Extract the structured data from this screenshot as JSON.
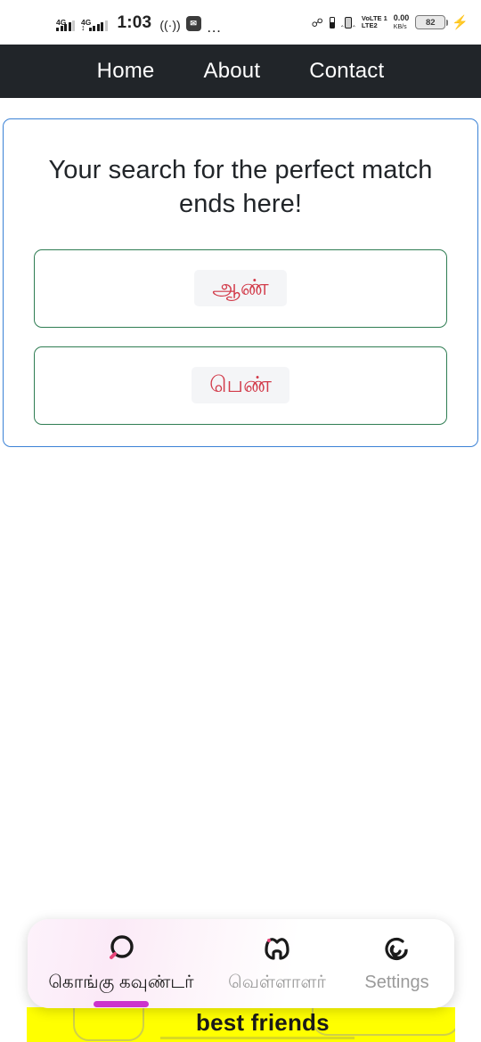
{
  "status_bar": {
    "network_1": "4G",
    "network_2": "4G",
    "time": "1:03",
    "wifi_calling_icon": "wifi-calling-icon",
    "app_notification_icon": "app-badge-icon",
    "more_icon": "more-dots-icon",
    "bluetooth_icon": "bluetooth-icon",
    "sim_icon": "sim-card-icon",
    "vibrate_icon": "vibrate-icon",
    "volte_line1": "VoLTE 1",
    "volte_line2": "LTE2",
    "data_rate": "0.00",
    "data_unit": "KB/s",
    "battery_percent": "82",
    "charging_icon": "charging-bolt-icon"
  },
  "navbar": {
    "links": [
      {
        "label": "Home"
      },
      {
        "label": "About"
      },
      {
        "label": "Contact"
      }
    ]
  },
  "hero": {
    "heading": "Your search for the perfect match ends here!",
    "options": [
      {
        "label": "ஆண்"
      },
      {
        "label": "பெண்"
      }
    ],
    "border_color": "#3b82d6",
    "option_border_color": "#2f7d53",
    "option_text_color": "#d23b4a"
  },
  "background_banner": {
    "text": "best friends",
    "background_color": "#ffff00"
  },
  "bottom_nav": {
    "items": [
      {
        "label": "கொங்கு கவுண்டர்",
        "icon": "search-ring-icon",
        "active": true
      },
      {
        "label": "வெள்ளாளர்",
        "icon": "home-icon",
        "active": false
      },
      {
        "label": "Settings",
        "icon": "spiral-refresh-icon",
        "active": false
      }
    ],
    "indicator_color": "#cc33cc"
  }
}
